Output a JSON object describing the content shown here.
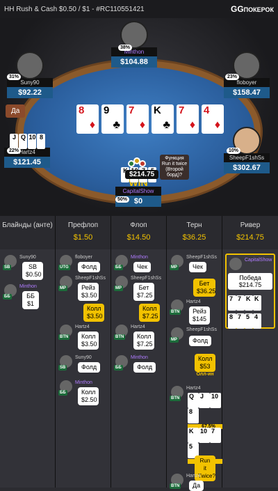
{
  "header": {
    "title": "HH Rush & Cash $0.50 / $1 - #RC110551421",
    "logo_gg": "GG",
    "logo_text": "ПОКЕРОК"
  },
  "seats": {
    "top": {
      "name": "Minthon",
      "stack": "$104.88",
      "pct": "38%"
    },
    "left": {
      "name": "Suny90",
      "stack": "$92.22",
      "pct": "31%"
    },
    "right": {
      "name": "floboyer",
      "stack": "$158.47",
      "pct": "23%"
    },
    "lefttwo": {
      "name": "Hartz4",
      "stack": "$121.45",
      "pct": "22%"
    },
    "righttwo": {
      "name": "SheepF1shSs",
      "stack": "$302.67",
      "pct": "10%"
    },
    "bottom": {
      "name": "CapitalShow",
      "stack": "$0",
      "pct": "50%",
      "win": "WIN"
    }
  },
  "yes_button": "Да",
  "board": [
    {
      "r": "8",
      "s": "♦",
      "red": true
    },
    {
      "r": "9",
      "s": "♣",
      "red": false
    },
    {
      "r": "7",
      "s": "♦",
      "red": true
    },
    {
      "r": "K",
      "s": "♣",
      "red": false
    },
    {
      "r": "7",
      "s": "♦",
      "red": true
    },
    {
      "r": "4",
      "s": "♦",
      "red": true
    }
  ],
  "pot": "$214.75",
  "runit_tooltip": "Функция Run it twice (Второй борд)?",
  "columns": [
    {
      "label": "Блайнды (анте)",
      "amount": ""
    },
    {
      "label": "Префлоп",
      "amount": "$1.50"
    },
    {
      "label": "Флоп",
      "amount": "$14.50"
    },
    {
      "label": "Терн",
      "amount": "$36.25"
    },
    {
      "label": "Ривер",
      "amount": "$214.75"
    }
  ],
  "actions": {
    "blinds": [
      {
        "name": "Suny90",
        "pos": "SB",
        "text": "SB $0.50"
      },
      {
        "name": "Minthon",
        "pos": "ББ",
        "text": "ББ $1"
      }
    ],
    "preflop": [
      {
        "name": "floboyer",
        "pos": "UTG",
        "text": "Фолд"
      },
      {
        "name": "SheepF1shSs",
        "pos": "MP",
        "text": "Рейз $3.50"
      },
      {
        "name": "",
        "pos": "",
        "text": "Колл $3.50"
      },
      {
        "name": "Hartz4",
        "pos": "BTN",
        "text": "Колл $3.50"
      },
      {
        "name": "Suny90",
        "pos": "SB",
        "text": "Фолд"
      },
      {
        "name": "Minthon",
        "pos": "ББ",
        "text": "Колл $2.50"
      }
    ],
    "flop": [
      {
        "name": "Minthon",
        "pos": "ББ",
        "text": "Чек"
      },
      {
        "name": "SheepF1shSs",
        "pos": "MP",
        "text": "Бет $7.25"
      },
      {
        "name": "",
        "pos": "",
        "text": "Колл $7.25"
      },
      {
        "name": "Hartz4",
        "pos": "BTN",
        "text": "Колл $7.25"
      },
      {
        "name": "Minthon",
        "pos": "ББ",
        "text": "Фолд"
      }
    ],
    "turn": [
      {
        "name": "SheepF1shSs",
        "pos": "MP",
        "text": "Чек"
      },
      {
        "name": "",
        "pos": "",
        "text": "Бет $36.25"
      },
      {
        "name": "Hartz4",
        "pos": "BTN",
        "text": "Рейз $145"
      },
      {
        "name": "SheepF1shSs",
        "pos": "MP",
        "text": "Фолд"
      },
      {
        "name": "",
        "pos": "",
        "text": "Колл $53"
      },
      {
        "name": "",
        "pos": "",
        "text": "Олл-ин"
      },
      {
        "name": "Hartz4",
        "pos": "BTN",
        "text": "67.5%"
      },
      {
        "name": "",
        "pos": "",
        "text": "32.5%"
      },
      {
        "name": "",
        "pos": "",
        "text": "Run it Twice?"
      },
      {
        "name": "Hartz4",
        "pos": "BTN",
        "text": "Да"
      }
    ],
    "river": {
      "name": "CapitalShow",
      "win_label": "Победа",
      "win_amount": "$214.75"
    }
  }
}
